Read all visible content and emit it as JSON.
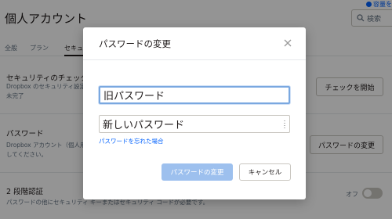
{
  "page": {
    "title": "個人アカウント",
    "top_right_link": "容量を",
    "search_placeholder": "検索"
  },
  "tabs": [
    {
      "label": "全般"
    },
    {
      "label": "プラン"
    },
    {
      "label": "セキュ"
    }
  ],
  "sections": {
    "security_check": {
      "title": "セキュリティのチェック",
      "desc_line1": "Dropbox のセキュリティ設定",
      "desc_line2": "未完了",
      "button": "チェックを開始"
    },
    "password": {
      "title": "パスワード",
      "desc_line1": "Dropbox アカウント（個人用",
      "desc_line2": "してください。",
      "button": "パスワードの変更"
    },
    "two_step": {
      "title": "2 段階認証",
      "desc": "パスワードの他にセキュリティ キーまたはセキュリティ コードが必要です。",
      "toggle_label": "オフ",
      "toggle_on": false
    }
  },
  "modal": {
    "title": "パスワードの変更",
    "old_password_placeholder": "旧パスワード",
    "new_password_placeholder": "新しいパスワード",
    "forgot_link": "パスワードを忘れた場合",
    "submit_label": "パスワードの変更",
    "cancel_label": "キャンセル"
  },
  "colors": {
    "accent": "#0061fe",
    "primary_disabled": "#9dc0ee",
    "overlay": "rgba(0,0,0,0.42)"
  }
}
